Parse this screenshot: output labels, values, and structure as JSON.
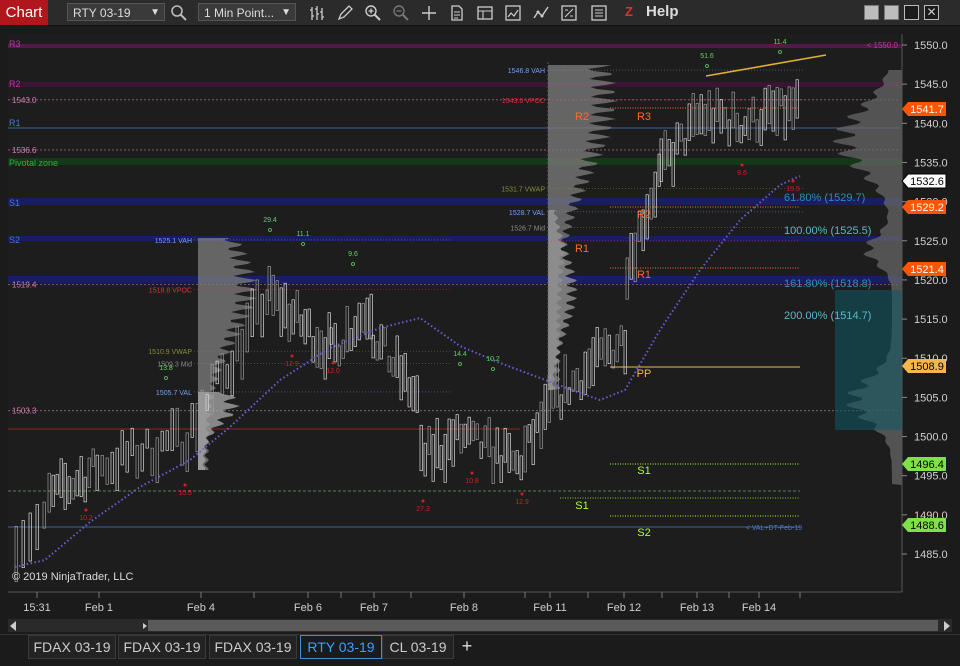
{
  "app": {
    "title": "Chart",
    "help": "Help"
  },
  "toolbar": {
    "instrument": "RTY 03-19",
    "interval": "1 Min Point...",
    "icons": [
      "magnifier-icon",
      "bar-chart-icon",
      "pencil-icon",
      "zoom-in-icon",
      "zoom-out-icon",
      "crosshair-icon",
      "properties-icon",
      "templates-icon",
      "indicators-icon",
      "strategies-icon",
      "data-box-icon",
      "help-z-icon"
    ]
  },
  "tabs": [
    "FDAX 03-19",
    "FDAX 03-19",
    "FDAX 03-19",
    "RTY 03-19",
    "CL 03-19"
  ],
  "active_tab": 3,
  "copyright": "© 2019 NinjaTrader, LLC",
  "colors": {
    "up": "#d9d9d9",
    "down": "#9a9a9a",
    "accent": "#b0171c",
    "vwap_dots": "#6a5cd8",
    "price_tag": "#ff5500"
  },
  "chart_data": {
    "type": "bar",
    "ylim": [
      1481,
      1552
    ],
    "y_ticks": [
      "1550.0",
      "1545.0",
      "1540.0",
      "1535.0",
      "1530.0",
      "1525.0",
      "1520.0",
      "1515.0",
      "1510.0",
      "1505.0",
      "1500.0",
      "1495.0",
      "1490.0",
      "1485.0"
    ],
    "x_labels": [
      "15:31",
      "Feb 1",
      "Feb 4",
      "Feb 6",
      "Feb 7",
      "Feb 8",
      "Feb 11",
      "Feb 12",
      "Feb 13",
      "Feb 14"
    ],
    "price_tags": [
      {
        "label": "1541.7",
        "bg": "#ff5500",
        "fg": "#ffffff"
      },
      {
        "label": "1532.6",
        "bg": "#ffffff",
        "fg": "#000000"
      },
      {
        "label": "1529.2",
        "bg": "#ff5500",
        "fg": "#ffffff"
      },
      {
        "label": "1521.4",
        "bg": "#ff5500",
        "fg": "#ffffff"
      },
      {
        "label": "1508.9",
        "bg": "#f2b84b",
        "fg": "#000000"
      },
      {
        "label": "1496.4",
        "bg": "#7ee14a",
        "fg": "#000000"
      },
      {
        "label": "1488.6",
        "bg": "#7ee14a",
        "fg": "#000000"
      }
    ],
    "pivot_labels": [
      "R3",
      "R2",
      "R1",
      "PP",
      "S1",
      "S2",
      "Pivotal zone"
    ],
    "left_levels": [
      {
        "y": 1543.0,
        "label": "1543.0",
        "color": "#d27fb3"
      },
      {
        "y": 1536.6,
        "label": "1536.6",
        "color": "#d27fb3"
      },
      {
        "y": 1519.4,
        "label": "1519.4",
        "color": "#d27fb3"
      },
      {
        "y": 1503.3,
        "label": "1503.3",
        "color": "#d27fb3"
      }
    ],
    "profile_labels": [
      {
        "y": 1546.8,
        "label": "1546.8 VAH",
        "color": "#6fa0ff"
      },
      {
        "y": 1543.0,
        "label": "1543.0 VPOC",
        "color": "#e0303a"
      },
      {
        "y": 1531.7,
        "label": "1531.7 VWAP",
        "color": "#8b8b3a"
      },
      {
        "y": 1528.7,
        "label": "1528.7 VAL",
        "color": "#6fa0ff"
      },
      {
        "y": 1526.7,
        "label": "1526.7 Mid",
        "color": "#8a8a8a"
      },
      {
        "y": 1525.1,
        "label": "1525.1 VAH",
        "color": "#6fa0ff"
      },
      {
        "y": 1518.8,
        "label": "1518.8 VPOC",
        "color": "#e0303a"
      },
      {
        "y": 1510.9,
        "label": "1510.9 VWAP",
        "color": "#8b8b3a"
      },
      {
        "y": 1509.3,
        "label": "1509.3 Mid",
        "color": "#8a8a8a"
      },
      {
        "y": 1505.7,
        "label": "1505.7 VAL",
        "color": "#6fa0ff"
      }
    ],
    "fib_labels": [
      {
        "label": "61.80% (1529.7)",
        "color": "#2f8fb0"
      },
      {
        "label": "100.00% (1525.5)",
        "color": "#5ab8c8"
      },
      {
        "label": "161.80% (1518.8)",
        "color": "#2f8fb0"
      },
      {
        "label": "200.00% (1514.7)",
        "color": "#5ab8c8"
      }
    ],
    "right_labels": [
      "< 1550.0",
      "< VAL+DT-Feb-19"
    ],
    "swing_high_labels": [
      "29.4",
      "11.1",
      "9.6",
      "14.4",
      "10.2",
      "51.6",
      "11.4",
      "13.8"
    ],
    "swing_low_labels": [
      "10.2",
      "10.5",
      "12.9",
      "12.0",
      "27.3",
      "10.8",
      "12.9",
      "9.6",
      "15.5"
    ]
  }
}
